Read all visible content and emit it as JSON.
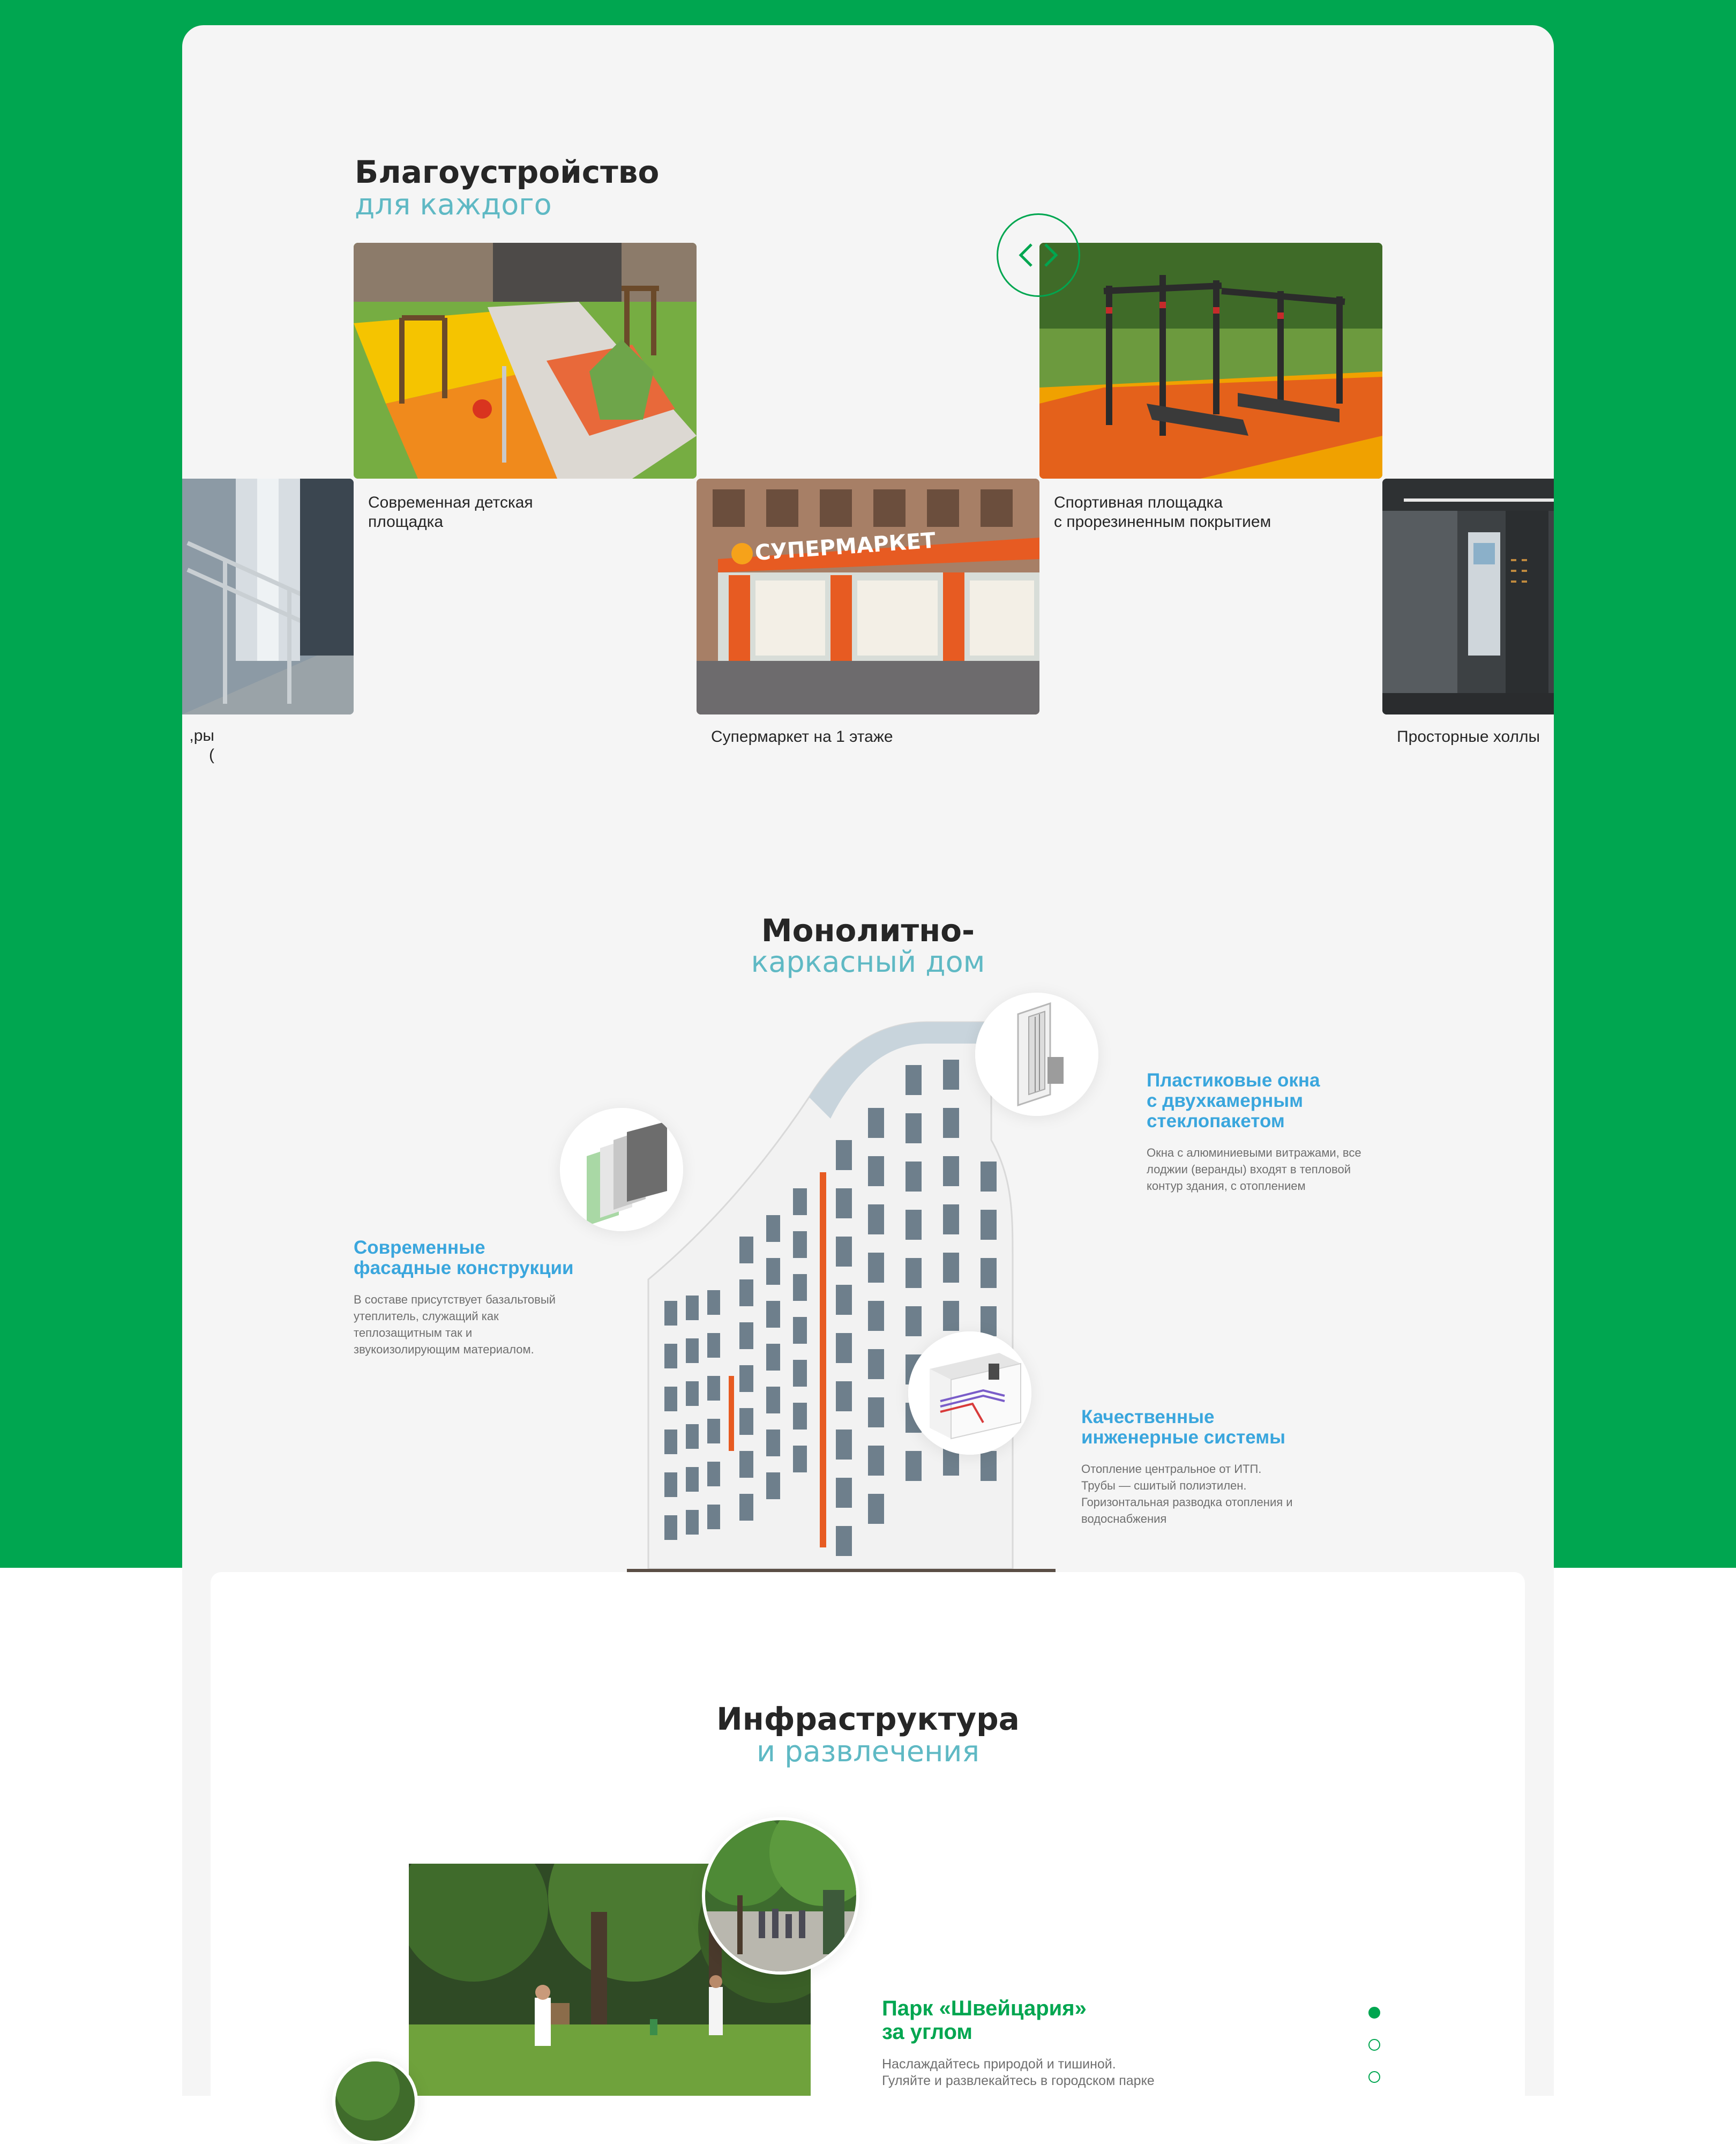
{
  "colors": {
    "brand_green": "#00a650",
    "accent_teal": "#5fb9c4",
    "accent_blue": "#3aa6dd",
    "text_dark": "#262626",
    "text_muted": "#6f6f6f"
  },
  "landscaping": {
    "title": "Благоустройство",
    "subtitle": "для каждого",
    "nav_icon": "chevron-left-right-icon",
    "cards": [
      {
        "caption": "ры,\n)"
      },
      {
        "caption": "Современная детская\nплощадка"
      },
      {
        "caption": "Супермаркет на 1 этаже",
        "sign": "СУПЕРМАРКЕТ"
      },
      {
        "caption": "Спортивная площадка\nс прорезиненным покрытием"
      },
      {
        "caption": "Просторные холлы"
      }
    ]
  },
  "monolith": {
    "title": "Монолитно-",
    "subtitle": "каркасный дом",
    "features": [
      {
        "title": "Пластиковые окна\nс двухкамерным\nстеклопакетом",
        "text": "Окна с алюминиевыми витражами, все\nлоджии (веранды) входят в тепловой\nконтур здания, с отоплением"
      },
      {
        "title": "Современные\nфасадные конструкции",
        "text": "В составе присутствует базальтовый\nутеплитель, служащий как\nтеплозащитным так и\nзвукоизолирующим материалом."
      },
      {
        "title": "Качественные\nинженерные системы",
        "text": "Отопление центральное от ИТП.\nТрубы — сшитый полиэтилен.\nГоризонтальная разводка отопления и\nводоснабжения"
      }
    ]
  },
  "infrastructure": {
    "title": "Инфраструктура",
    "subtitle": "и развлечения",
    "slide": {
      "title": "Парк «Швейцария»\nза углом",
      "text": "Наслаждайтесь природой и тишиной.\nГуляйте и развлекайтесь в городском парке"
    },
    "pagination": {
      "total": 3,
      "active": 1
    }
  }
}
